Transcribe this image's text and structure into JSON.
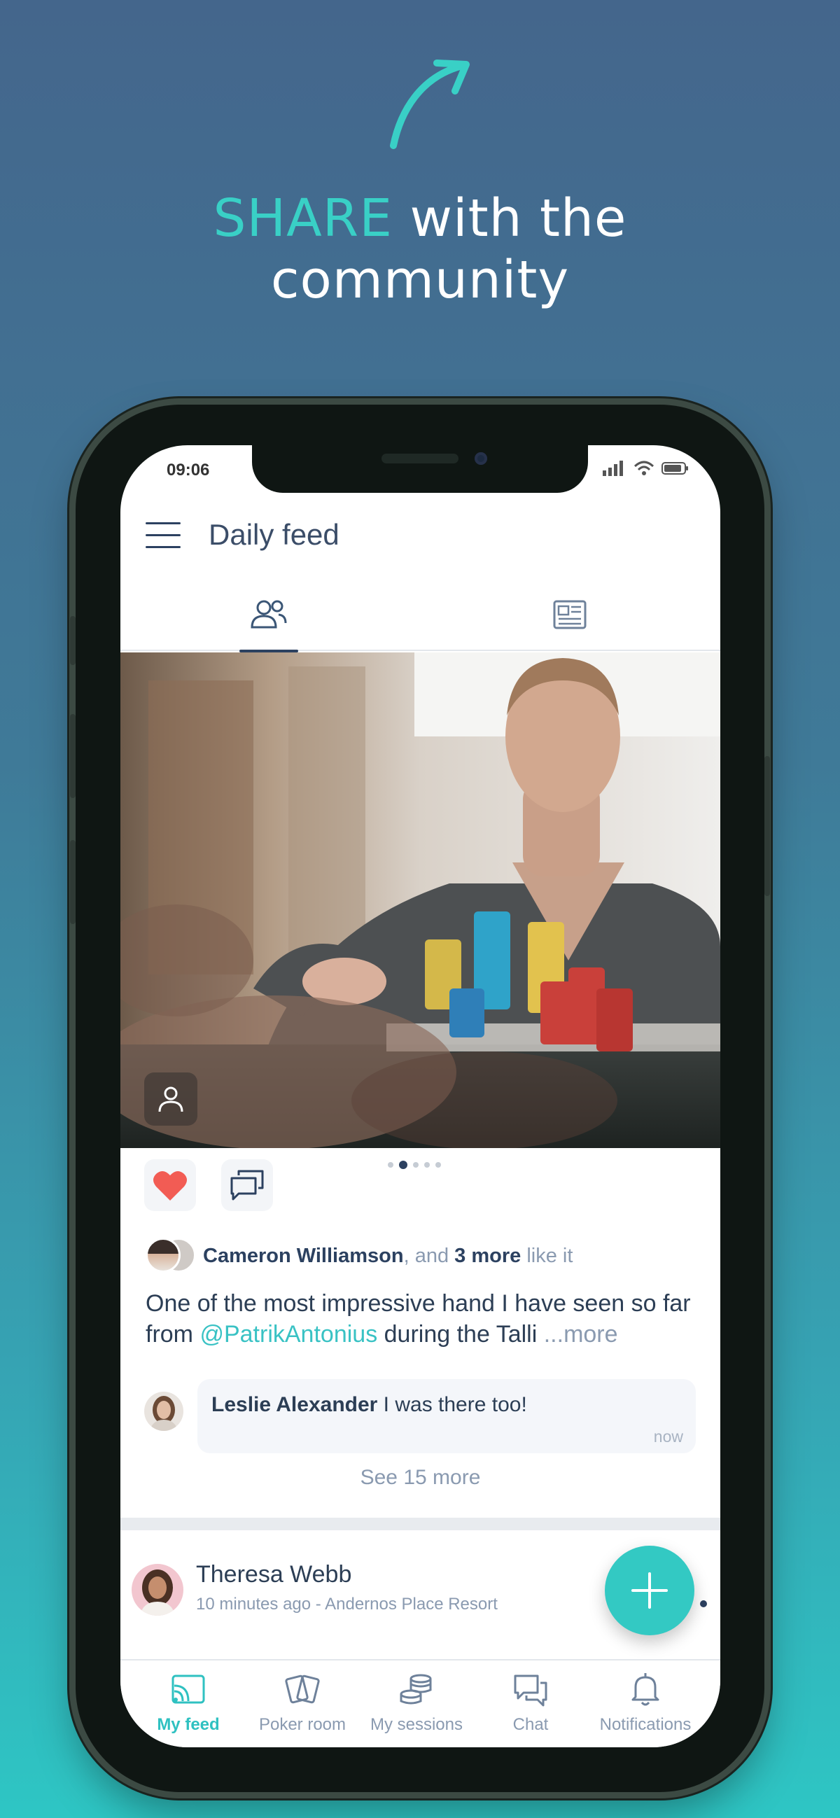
{
  "marketing": {
    "headline_accent": "SHARE",
    "headline_rest": " with the",
    "headline_line2": "community"
  },
  "status_bar": {
    "time": "09:06"
  },
  "header": {
    "title": "Daily feed"
  },
  "tabs": [
    {
      "name": "people",
      "icon": "people-icon",
      "active": true
    },
    {
      "name": "news",
      "icon": "newspaper-icon",
      "active": false
    }
  ],
  "post": {
    "carousel": {
      "count": 5,
      "active_index": 1
    },
    "likes": {
      "name": "Cameron Williamson",
      "separator": ", and",
      "count_text": "3 more",
      "suffix": "like it"
    },
    "text_start": "One of the most impressive hand I have seen so far from ",
    "mention": "@PatrikAntonius",
    "text_end": " during the Talli ",
    "more_link": "...more",
    "comment": {
      "author": "Leslie Alexander",
      "text": " I was there too!",
      "time": "now"
    },
    "see_more": "See 15 more"
  },
  "post2": {
    "author": "Theresa Webb",
    "meta": "10 minutes ago - Andernos Place Resort"
  },
  "bottom_nav": [
    {
      "label": "My feed",
      "icon": "cast-icon",
      "active": true
    },
    {
      "label": "Poker room",
      "icon": "cards-icon",
      "active": false
    },
    {
      "label": "My sessions",
      "icon": "chips-icon",
      "active": false
    },
    {
      "label": "Chat",
      "icon": "chat-icon",
      "active": false
    },
    {
      "label": "Notifications",
      "icon": "bell-icon",
      "active": false
    }
  ],
  "colors": {
    "accent": "#33c9c3",
    "navy": "#2c4160",
    "like": "#f25c54"
  }
}
